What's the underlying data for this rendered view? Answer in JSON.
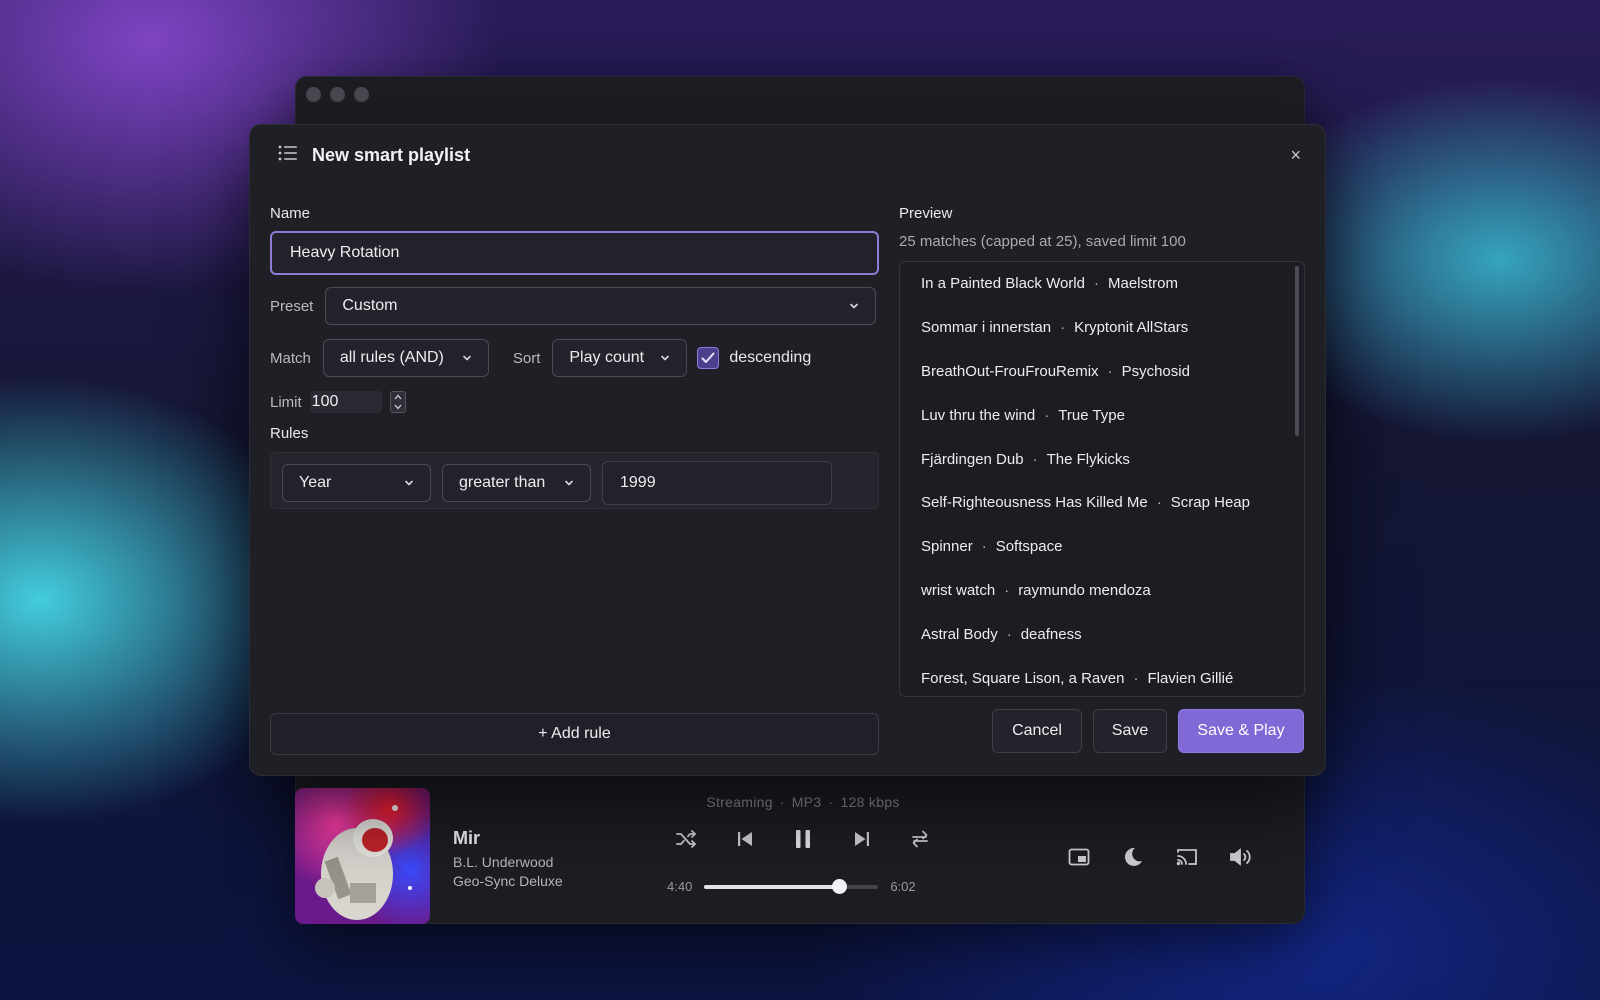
{
  "dialog": {
    "title": "New smart playlist",
    "close_label": "×",
    "name_label": "Name",
    "name_value": "Heavy Rotation",
    "preset_label": "Preset",
    "preset_value": "Custom",
    "match_label": "Match",
    "match_value": "all rules (AND)",
    "sort_label": "Sort",
    "sort_value": "Play count",
    "descending_label": "descending",
    "descending_checked": true,
    "limit_label": "Limit",
    "limit_value": "100",
    "rules_label": "Rules",
    "rules": [
      {
        "field": "Year",
        "operator": "greater than",
        "value": "1999"
      }
    ],
    "add_rule_label": "+ Add rule",
    "preview_label": "Preview",
    "preview_summary": "25 matches (capped at 25), saved limit 100",
    "preview_items": [
      {
        "title": "In a Painted Black World",
        "artist": "Maelstrom"
      },
      {
        "title": "Sommar i innerstan",
        "artist": "Kryptonit AllStars"
      },
      {
        "title": "BreathOut-FrouFrouRemix",
        "artist": "Psychosid"
      },
      {
        "title": "Luv thru the wind",
        "artist": "True Type"
      },
      {
        "title": "Fjärdingen Dub",
        "artist": "The Flykicks"
      },
      {
        "title": "Self-Righteousness Has Killed Me",
        "artist": "Scrap Heap"
      },
      {
        "title": "Spinner",
        "artist": "Softspace"
      },
      {
        "title": "wrist watch",
        "artist": "raymundo mendoza"
      },
      {
        "title": "Astral Body",
        "artist": "deafness"
      },
      {
        "title": "Forest, Square Lison, a Raven",
        "artist": "Flavien Gillié"
      }
    ],
    "preview_separator": "·",
    "cancel_label": "Cancel",
    "save_label": "Save",
    "save_play_label": "Save & Play"
  },
  "player": {
    "title": "Mir",
    "artist": "B.L. Underwood",
    "album": "Geo-Sync Deluxe",
    "stream_source": "Streaming",
    "format": "MP3",
    "bitrate": "128 kbps",
    "elapsed": "4:40",
    "duration": "6:02",
    "progress_fraction": 0.775,
    "icons": [
      "shuffle-icon",
      "previous-icon",
      "pause-icon",
      "next-icon",
      "repeat-icon",
      "miniplayer-icon",
      "sleep-timer-icon",
      "cast-icon",
      "volume-icon"
    ]
  },
  "colors": {
    "accent": "#8069d6",
    "focus_border": "#8f7ad6",
    "dialog_bg": "#1f2026"
  }
}
